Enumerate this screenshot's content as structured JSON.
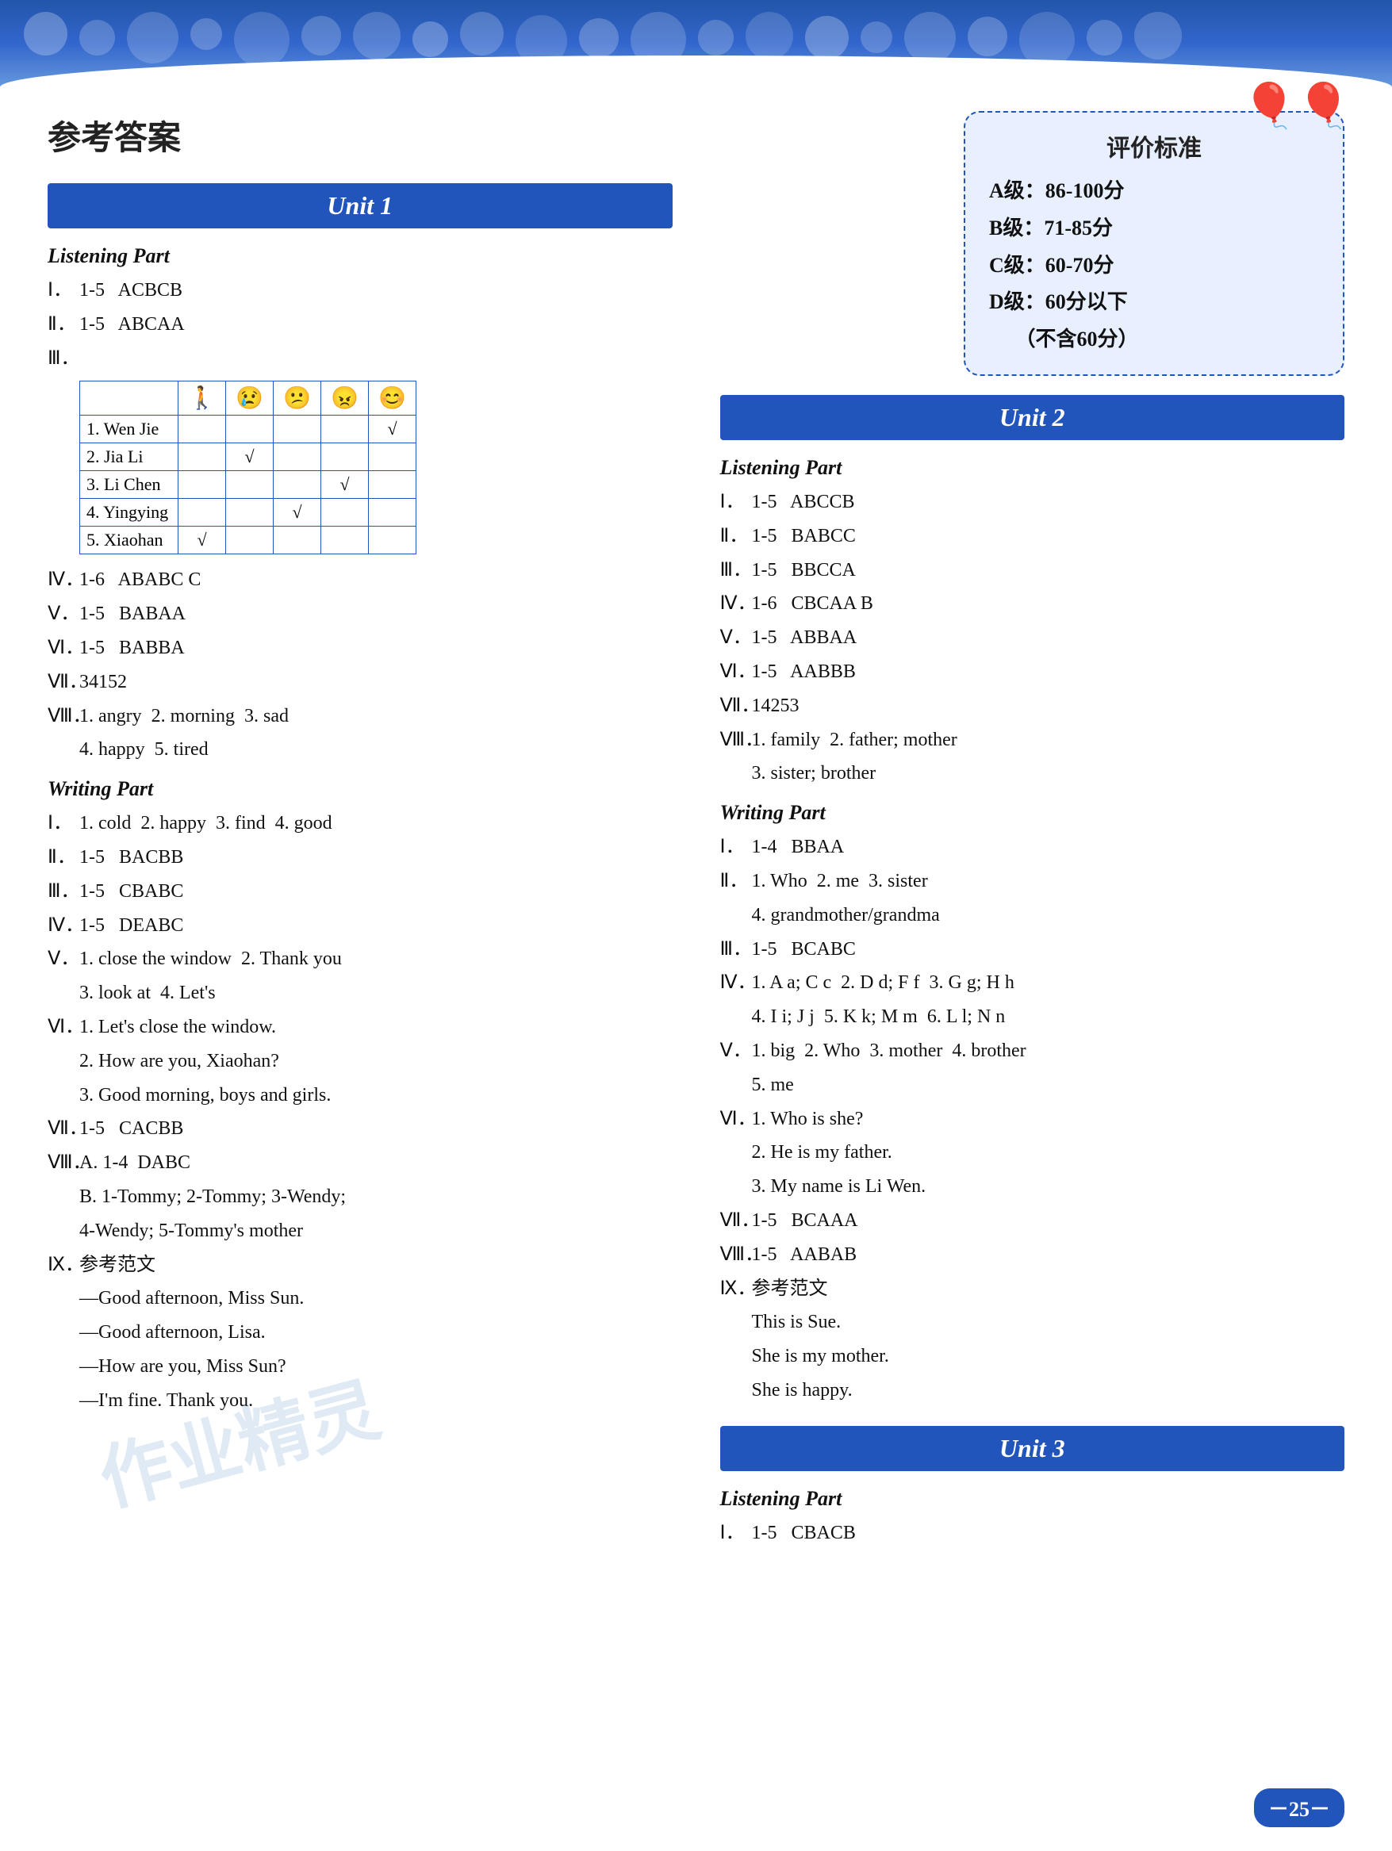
{
  "page": {
    "title": "参考答案",
    "page_number": "－25－"
  },
  "eval_box": {
    "title": "评价标准",
    "grades": [
      {
        "label": "A级：",
        "range": "86-100分"
      },
      {
        "label": "B级：",
        "range": "71-85分"
      },
      {
        "label": "C级：",
        "range": "60-70分"
      },
      {
        "label": "D级：",
        "range": "60分以下"
      },
      {
        "label": "",
        "range": "（不含60分）"
      }
    ]
  },
  "unit1": {
    "header": "Unit 1",
    "listening_label": "Listening Part",
    "items": [
      {
        "roman": "Ⅰ．",
        "range": "1-5",
        "answer": "ACBCB"
      },
      {
        "roman": "Ⅱ．",
        "range": "1-5",
        "answer": "ABCAA"
      },
      {
        "roman": "Ⅲ．",
        "label": "table"
      },
      {
        "roman": "Ⅳ．",
        "range": "1-6",
        "answer": "ABABC C"
      },
      {
        "roman": "Ⅴ．",
        "range": "1-5",
        "answer": "BABAA"
      },
      {
        "roman": "Ⅵ．",
        "range": "1-5",
        "answer": "BABBA"
      },
      {
        "roman": "Ⅶ．",
        "answer": "34152"
      },
      {
        "roman": "Ⅷ．",
        "answer": "1. angry  2. morning  3. sad"
      },
      {
        "roman": "",
        "answer": "4. happy  5. tired"
      }
    ],
    "table": {
      "headers": [
        "",
        "🚶",
        "😢",
        "😕",
        "😠",
        "😊"
      ],
      "rows": [
        {
          "name": "1. Wen Jie",
          "checks": [
            false,
            false,
            false,
            false,
            true
          ]
        },
        {
          "name": "2. Jia Li",
          "checks": [
            false,
            true,
            false,
            false,
            false
          ]
        },
        {
          "name": "3. Li Chen",
          "checks": [
            false,
            false,
            false,
            true,
            false
          ]
        },
        {
          "name": "4. Yingying",
          "checks": [
            false,
            false,
            true,
            false,
            false
          ]
        },
        {
          "name": "5. Xiaohan",
          "checks": [
            true,
            false,
            false,
            false,
            false
          ]
        }
      ]
    },
    "writing_label": "Writing Part",
    "writing_items": [
      {
        "roman": "Ⅰ．",
        "answer": "1. cold  2. happy  3. find  4. good"
      },
      {
        "roman": "Ⅱ．",
        "range": "1-5",
        "answer": "BACBB"
      },
      {
        "roman": "Ⅲ．",
        "range": "1-5",
        "answer": "CBABC"
      },
      {
        "roman": "Ⅳ．",
        "range": "1-5",
        "answer": "DEABC"
      },
      {
        "roman": "Ⅴ．",
        "answer": "1. close the window  2. Thank you"
      },
      {
        "roman": "",
        "answer": "3. look at  4. Let's"
      },
      {
        "roman": "Ⅵ．",
        "answer": "1. Let's close the window."
      },
      {
        "roman": "",
        "answer": "2. How are you, Xiaohan?"
      },
      {
        "roman": "",
        "answer": "3. Good morning, boys and girls."
      },
      {
        "roman": "Ⅶ．",
        "range": "1-5",
        "answer": "CACBB"
      },
      {
        "roman": "Ⅷ．",
        "answer": "A. 1-4  DABC"
      },
      {
        "roman": "",
        "answer": "B. 1-Tommy; 2-Tommy; 3-Wendy;"
      },
      {
        "roman": "",
        "answer": "4-Wendy; 5-Tommy's mother"
      },
      {
        "roman": "Ⅸ．",
        "answer": "参考范文"
      },
      {
        "roman": "",
        "answer": "—Good afternoon, Miss Sun."
      },
      {
        "roman": "",
        "answer": "—Good afternoon, Lisa."
      },
      {
        "roman": "",
        "answer": "—How are you, Miss Sun?"
      },
      {
        "roman": "",
        "answer": "—I'm fine. Thank you."
      }
    ]
  },
  "unit2": {
    "header": "Unit 2",
    "listening_label": "Listening Part",
    "items": [
      {
        "roman": "Ⅰ．",
        "range": "1-5",
        "answer": "ABCCB"
      },
      {
        "roman": "Ⅱ．",
        "range": "1-5",
        "answer": "BABCC"
      },
      {
        "roman": "Ⅲ．",
        "range": "1-5",
        "answer": "BBCCA"
      },
      {
        "roman": "Ⅳ．",
        "range": "1-6",
        "answer": "CBCAA B"
      },
      {
        "roman": "Ⅴ．",
        "range": "1-5",
        "answer": "ABBAA"
      },
      {
        "roman": "Ⅵ．",
        "range": "1-5",
        "answer": "AABBB"
      },
      {
        "roman": "Ⅶ．",
        "answer": "14253"
      },
      {
        "roman": "Ⅷ．",
        "answer": "1. family  2. father; mother"
      },
      {
        "roman": "",
        "answer": "3. sister; brother"
      }
    ],
    "writing_label": "Writing Part",
    "writing_items": [
      {
        "roman": "Ⅰ．",
        "range": "1-4",
        "answer": "BBAA"
      },
      {
        "roman": "Ⅱ．",
        "answer": "1. Who  2. me  3. sister"
      },
      {
        "roman": "",
        "answer": "4. grandmother/grandma"
      },
      {
        "roman": "Ⅲ．",
        "range": "1-5",
        "answer": "BCABC"
      },
      {
        "roman": "Ⅳ．",
        "answer": "1. A a; C c  2. D d; F f  3. G g; H h"
      },
      {
        "roman": "",
        "answer": "4. I i; J j  5. K k; M m  6. L l; N n"
      },
      {
        "roman": "Ⅴ．",
        "answer": "1. big  2. Who  3. mother  4. brother"
      },
      {
        "roman": "",
        "answer": "5. me"
      },
      {
        "roman": "Ⅵ．",
        "answer": "1. Who is she?"
      },
      {
        "roman": "",
        "answer": "2. He is my father."
      },
      {
        "roman": "",
        "answer": "3. My name is Li Wen."
      },
      {
        "roman": "Ⅶ．",
        "range": "1-5",
        "answer": "BCAAA"
      },
      {
        "roman": "Ⅷ．",
        "range": "1-5",
        "answer": "AABAB"
      },
      {
        "roman": "Ⅸ．",
        "answer": "参考范文"
      },
      {
        "roman": "",
        "answer": "This is Sue."
      },
      {
        "roman": "",
        "answer": "She is my mother."
      },
      {
        "roman": "",
        "answer": "She is happy."
      }
    ]
  },
  "unit3": {
    "header": "Unit 3",
    "listening_label": "Listening Part",
    "items": [
      {
        "roman": "Ⅰ．",
        "range": "1-5",
        "answer": "CBACB"
      }
    ]
  }
}
